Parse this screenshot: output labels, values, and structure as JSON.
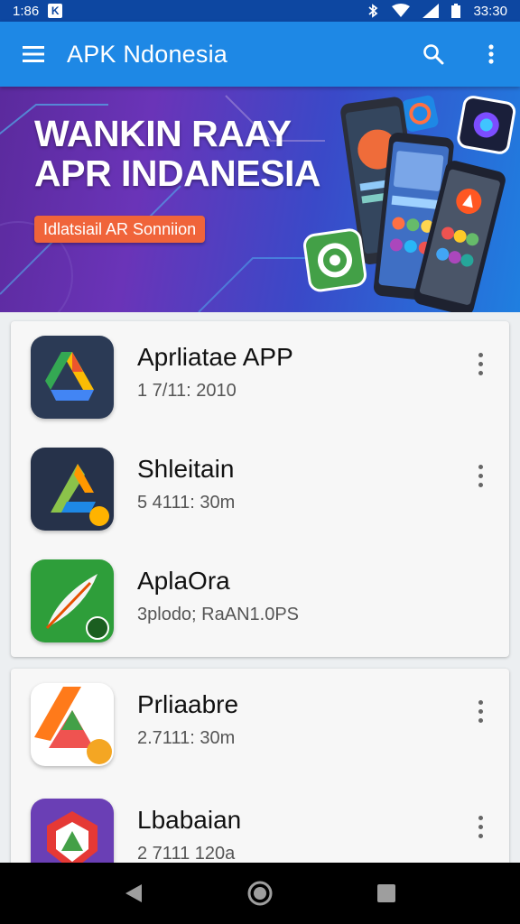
{
  "status_bar": {
    "time": "1:86",
    "clock_right": "33:30",
    "icons": [
      "notification-icon",
      "bluetooth-icon",
      "wifi-icon",
      "signal-icon",
      "battery-icon"
    ]
  },
  "app_bar": {
    "title": "APK Ndonesia",
    "icons": [
      "menu-icon",
      "search-icon",
      "more-vert-icon"
    ]
  },
  "banner": {
    "line1": "WANKIN RAAY",
    "line2": "APR INDANESIA",
    "cta": "Idlatsiail AR Sonniion"
  },
  "lists": [
    {
      "items": [
        {
          "name": "Aprliatae APP",
          "meta": "1 7/11: 2010",
          "icon": "drive-like-icon"
        },
        {
          "name": "Shleitain",
          "meta": "5 4111: 30m",
          "icon": "arrow-a-icon"
        },
        {
          "name": "AplaOra",
          "meta": "3plodo; RaAN1.0PS",
          "icon": "feather-icon"
        }
      ]
    },
    {
      "items": [
        {
          "name": "Prliaabre",
          "meta": "2.7111: 30m",
          "icon": "orange-a-icon"
        },
        {
          "name": "Lbabaian",
          "meta": "2 7111 120a",
          "icon": "shield-app-icon"
        }
      ]
    }
  ],
  "nav_bar": {
    "icons": [
      "back-icon",
      "home-icon",
      "recents-icon"
    ]
  },
  "colors": {
    "app_bar": "#1e88e5",
    "status_bar": "#0d47a1",
    "accent": "#f0643a"
  }
}
